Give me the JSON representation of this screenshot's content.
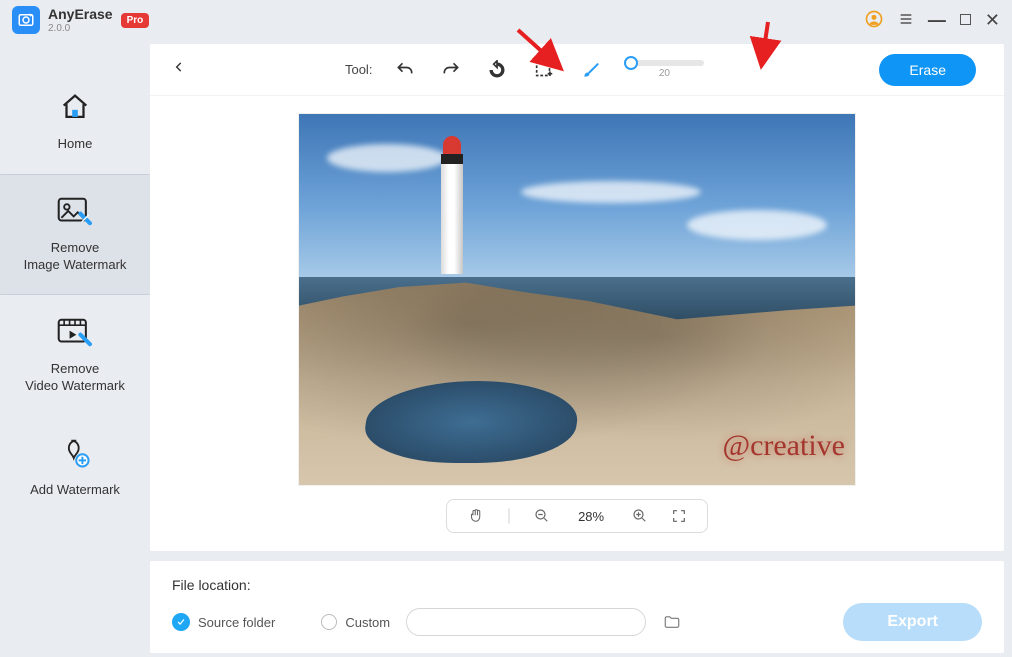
{
  "app": {
    "name": "AnyErase",
    "version": "2.0.0",
    "pro_badge": "Pro"
  },
  "sidebar": {
    "items": [
      {
        "label": "Home"
      },
      {
        "label": "Remove\nImage Watermark"
      },
      {
        "label": "Remove\nVideo Watermark"
      },
      {
        "label": "Add Watermark"
      }
    ]
  },
  "toolbar": {
    "tool_label": "Tool:",
    "brush_size": "20",
    "erase_label": "Erase"
  },
  "zoom": {
    "value": "28%"
  },
  "footer": {
    "title": "File location:",
    "source_label": "Source folder",
    "custom_label": "Custom",
    "path_value": "",
    "export_label": "Export"
  },
  "image": {
    "watermark_text": "@creative"
  }
}
